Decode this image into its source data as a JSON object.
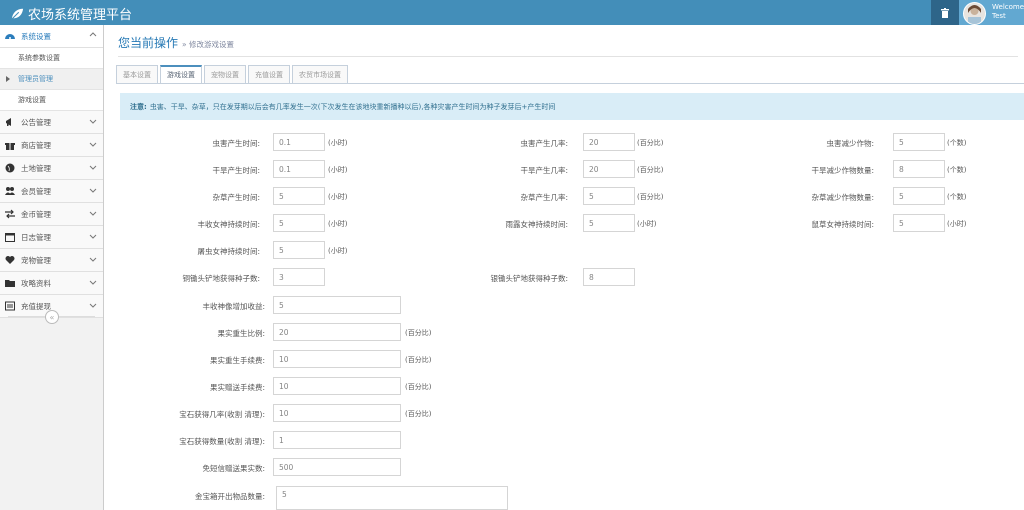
{
  "header": {
    "title": "农场系统管理平台",
    "welcome": "Welcome,",
    "user": "Test"
  },
  "sidebar": {
    "items": [
      {
        "label": "系统设置",
        "icon": "dashboard-icon",
        "open": true,
        "children": [
          {
            "label": "系统参数设置"
          },
          {
            "label": "管理员管理",
            "active": true
          },
          {
            "label": "游戏设置"
          }
        ]
      },
      {
        "label": "公告管理",
        "icon": "bullhorn-icon"
      },
      {
        "label": "商店管理",
        "icon": "gift-icon"
      },
      {
        "label": "土地管理",
        "icon": "globe-icon"
      },
      {
        "label": "会员管理",
        "icon": "users-icon"
      },
      {
        "label": "金币管理",
        "icon": "exchange-icon"
      },
      {
        "label": "日志管理",
        "icon": "calendar-icon"
      },
      {
        "label": "宠物管理",
        "icon": "heart-icon"
      },
      {
        "label": "攻略资料",
        "icon": "folder-icon"
      },
      {
        "label": "充值提现",
        "icon": "list-icon"
      }
    ]
  },
  "page": {
    "title": "您当前操作",
    "subtitle": "» 修改游戏设置"
  },
  "tabs": [
    {
      "label": "基本设置"
    },
    {
      "label": "游戏设置",
      "active": true
    },
    {
      "label": "宠物设置"
    },
    {
      "label": "充值设置"
    },
    {
      "label": "农贸市场设置"
    }
  ],
  "notice": {
    "strong": "注意:",
    "text": "虫害、干旱、杂草，只在发芽期以后会有几率发生一次(下次发生在该地块重新播种以后),各种灾害产生时间为种子发芽后+产生时间"
  },
  "form": {
    "rows": [
      [
        {
          "label": "虫害产生时间:",
          "value": "0.1",
          "unit": "(小时)"
        },
        {
          "label": "虫害产生几率:",
          "value": "20",
          "unit": "(百分比)"
        },
        {
          "label": "虫害减少作物:",
          "value": "5",
          "unit": "(个数)"
        }
      ],
      [
        {
          "label": "干旱产生时间:",
          "value": "0.1",
          "unit": "(小时)"
        },
        {
          "label": "干旱产生几率:",
          "value": "20",
          "unit": "(百分比)"
        },
        {
          "label": "干旱减少作物数量:",
          "value": "8",
          "unit": "(个数)"
        }
      ],
      [
        {
          "label": "杂草产生时间:",
          "value": "5",
          "unit": "(小时)"
        },
        {
          "label": "杂草产生几率:",
          "value": "5",
          "unit": "(百分比)"
        },
        {
          "label": "杂草减少作物数量:",
          "value": "5",
          "unit": "(个数)"
        }
      ],
      [
        {
          "label": "丰收女神持续时间:",
          "value": "5",
          "unit": "(小时)"
        },
        {
          "label": "雨露女神持续时间:",
          "value": "5",
          "unit": "(小时)"
        },
        {
          "label": "鼠草女神持续时间:",
          "value": "5",
          "unit": "(小时)"
        }
      ],
      [
        {
          "label": "屠虫女神持续时间:",
          "value": "5",
          "unit": "(小时)"
        }
      ],
      [
        {
          "label": "铜锄头铲地获得种子数:",
          "value": "3",
          "unit": ""
        },
        {
          "label": "银锄头铲地获得种子数:",
          "value": "8",
          "unit": ""
        }
      ]
    ],
    "wide": [
      {
        "label": "丰收神像增加收益:",
        "value": "5",
        "unit": ""
      },
      {
        "label": "果实重生比例:",
        "value": "20",
        "unit": "(百分比)"
      },
      {
        "label": "果实重生手续费:",
        "value": "10",
        "unit": "(百分比)"
      },
      {
        "label": "果实赠送手续费:",
        "value": "10",
        "unit": "(百分比)"
      },
      {
        "label": "宝石获得几率(收割 清理):",
        "value": "10",
        "unit": "(百分比)"
      },
      {
        "label": "宝石获得数量(收割 清理):",
        "value": "1",
        "unit": ""
      },
      {
        "label": "免短信赠送果实数:",
        "value": "500",
        "unit": ""
      },
      {
        "label": "金宝箱开出物品数量:",
        "value": "5",
        "unit": ""
      }
    ]
  }
}
